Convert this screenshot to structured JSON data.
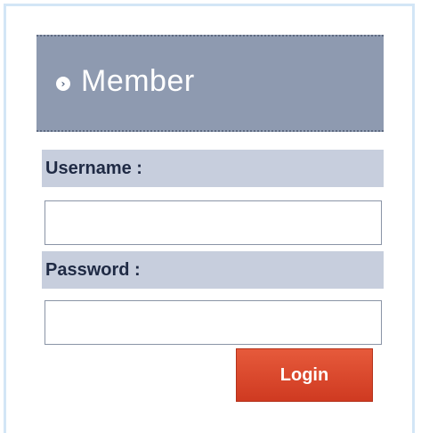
{
  "panel": {
    "title": "Member",
    "chevron_icon": "chevron-right-icon",
    "header_color": "#8e9ab0"
  },
  "form": {
    "username_label": "Username :",
    "username_value": "",
    "password_label": "Password :",
    "password_value": "",
    "login_label": "Login",
    "login_color": "#d8452a",
    "label_bar_color": "#c7cedd"
  }
}
